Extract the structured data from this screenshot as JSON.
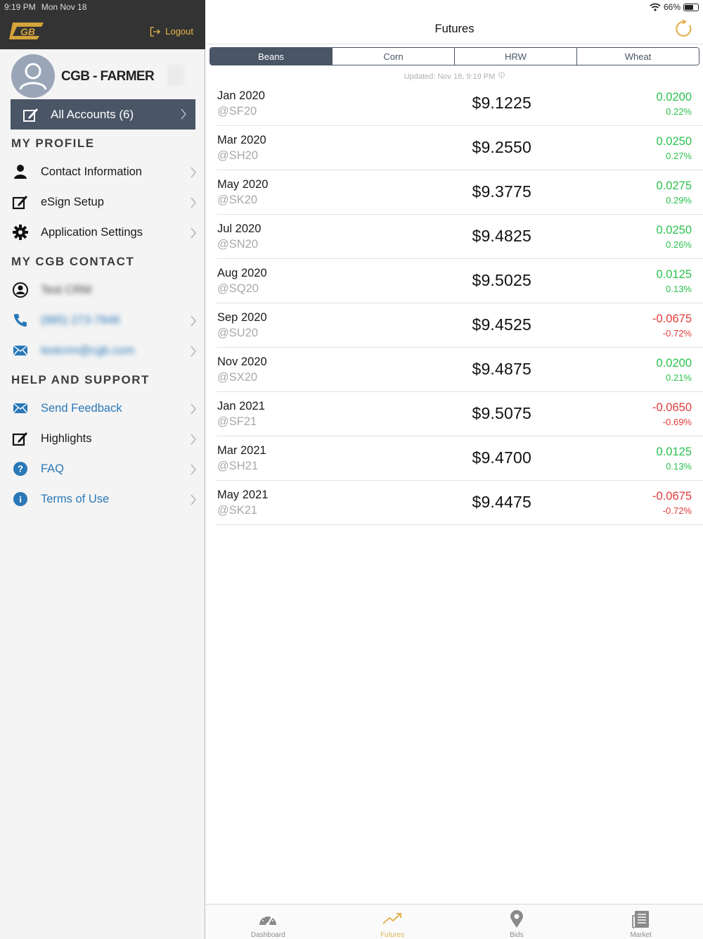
{
  "status_bar": {
    "time": "9:19 PM",
    "date": "Mon Nov 18",
    "battery": "66%"
  },
  "sidebar": {
    "logout_label": "Logout",
    "profile_name": "CGB - FARMER",
    "all_accounts_label": "All Accounts (6)",
    "sections": {
      "my_profile": "MY PROFILE",
      "my_contact": "MY CGB CONTACT",
      "help": "HELP AND SUPPORT"
    },
    "profile_items": [
      {
        "label": "Contact Information",
        "icon": "person-icon"
      },
      {
        "label": "eSign Setup",
        "icon": "edit-icon"
      },
      {
        "label": "Application Settings",
        "icon": "gear-icon"
      }
    ],
    "contact_items": [
      {
        "label": "Test CRM",
        "icon": "user-circle-icon"
      },
      {
        "label": "(985) 273-7846",
        "icon": "phone-icon"
      },
      {
        "label": "testcrm@cgb.com",
        "icon": "mail-icon"
      }
    ],
    "help_items": [
      {
        "label": "Send Feedback",
        "icon": "mail-icon"
      },
      {
        "label": "Highlights",
        "icon": "edit-icon"
      },
      {
        "label": "FAQ",
        "icon": "question-icon"
      },
      {
        "label": "Terms of Use",
        "icon": "info-icon"
      }
    ]
  },
  "main": {
    "title": "Futures",
    "tabs": [
      "Beans",
      "Corn",
      "HRW",
      "Wheat"
    ],
    "active_tab": "Beans",
    "updated": "Updated: Nov 18, 9:19 PM",
    "rows": [
      {
        "month": "Jan 2020",
        "symbol": "@SF20",
        "price": "$9.1225",
        "change": "0.0200",
        "percent": "0.22%",
        "direction": "up"
      },
      {
        "month": "Mar 2020",
        "symbol": "@SH20",
        "price": "$9.2550",
        "change": "0.0250",
        "percent": "0.27%",
        "direction": "up"
      },
      {
        "month": "May 2020",
        "symbol": "@SK20",
        "price": "$9.3775",
        "change": "0.0275",
        "percent": "0.29%",
        "direction": "up"
      },
      {
        "month": "Jul 2020",
        "symbol": "@SN20",
        "price": "$9.4825",
        "change": "0.0250",
        "percent": "0.26%",
        "direction": "up"
      },
      {
        "month": "Aug 2020",
        "symbol": "@SQ20",
        "price": "$9.5025",
        "change": "0.0125",
        "percent": "0.13%",
        "direction": "up"
      },
      {
        "month": "Sep 2020",
        "symbol": "@SU20",
        "price": "$9.4525",
        "change": "-0.0675",
        "percent": "-0.72%",
        "direction": "down"
      },
      {
        "month": "Nov 2020",
        "symbol": "@SX20",
        "price": "$9.4875",
        "change": "0.0200",
        "percent": "0.21%",
        "direction": "up"
      },
      {
        "month": "Jan 2021",
        "symbol": "@SF21",
        "price": "$9.5075",
        "change": "-0.0650",
        "percent": "-0.69%",
        "direction": "down"
      },
      {
        "month": "Mar 2021",
        "symbol": "@SH21",
        "price": "$9.4700",
        "change": "0.0125",
        "percent": "0.13%",
        "direction": "up"
      },
      {
        "month": "May 2021",
        "symbol": "@SK21",
        "price": "$9.4475",
        "change": "-0.0675",
        "percent": "-0.72%",
        "direction": "down"
      }
    ]
  },
  "tabbar": {
    "items": [
      {
        "label": "Dashboard",
        "icon": "speedometer-icon"
      },
      {
        "label": "Futures",
        "icon": "trending-up-icon"
      },
      {
        "label": "Bids",
        "icon": "map-pin-icon"
      },
      {
        "label": "Market",
        "icon": "newspaper-icon"
      }
    ],
    "active": "Futures"
  },
  "colors": {
    "sidebar_header": "#333333",
    "accent_gold": "#e2b452",
    "segment": "#4a5566",
    "positive": "#2bc24d",
    "negative": "#e23b3b",
    "link_blue": "#2a78b7"
  }
}
